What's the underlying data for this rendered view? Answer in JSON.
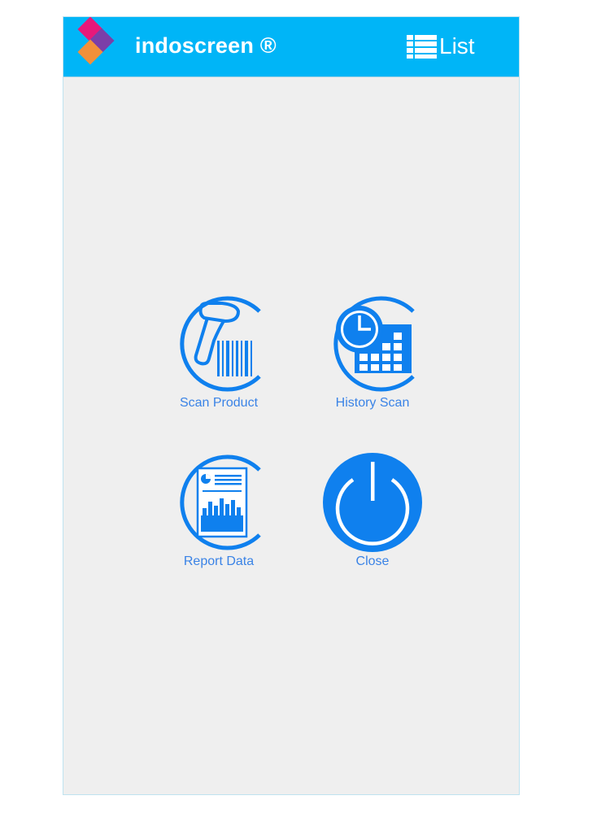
{
  "app_bar": {
    "title": "indoscreen ®",
    "list_label": "List",
    "background_color": "#00b5f7",
    "logo_colors": [
      "#e8187a",
      "#7b3fa8",
      "#f2903a"
    ]
  },
  "menu": {
    "accent_color": "#0f80ee",
    "items": [
      {
        "label": "Scan Product",
        "icon": "barcode-scanner-icon"
      },
      {
        "label": "History Scan",
        "icon": "clock-calendar-icon"
      },
      {
        "label": "Report Data",
        "icon": "report-chart-icon"
      },
      {
        "label": "Close",
        "icon": "power-icon"
      }
    ]
  }
}
